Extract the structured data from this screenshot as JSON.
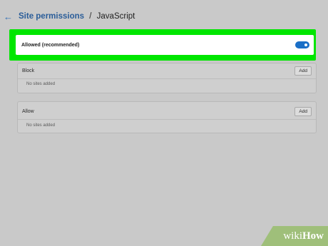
{
  "header": {
    "back_icon": "arrow-left-icon",
    "breadcrumb_parent": "Site permissions",
    "separator": "/",
    "current": "JavaScript"
  },
  "allowed": {
    "label": "Allowed (recommended)",
    "toggle_on": true,
    "highlight_color": "#00e600",
    "toggle_color": "#1a6fc7"
  },
  "block": {
    "title": "Block",
    "add_label": "Add",
    "empty_text": "No sites added"
  },
  "allow": {
    "title": "Allow",
    "add_label": "Add",
    "empty_text": "No sites added"
  },
  "watermark": {
    "prefix": "wiki",
    "suffix": "How"
  }
}
